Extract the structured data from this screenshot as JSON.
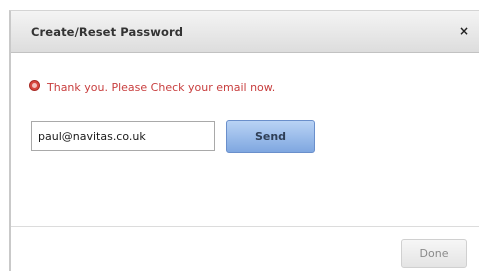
{
  "dialog": {
    "title": "Create/Reset Password",
    "close_label": "×",
    "message": {
      "icon": "error-circle-icon",
      "text": "Thank you. Please Check your email now.",
      "color": "#c83e3e"
    },
    "email_field": {
      "value": "paul@navitas.co.uk",
      "placeholder": ""
    },
    "send_label": "Send",
    "done_label": "Done"
  },
  "colors": {
    "accent_button": "#8fb3e8",
    "message_text": "#c83e3e"
  }
}
